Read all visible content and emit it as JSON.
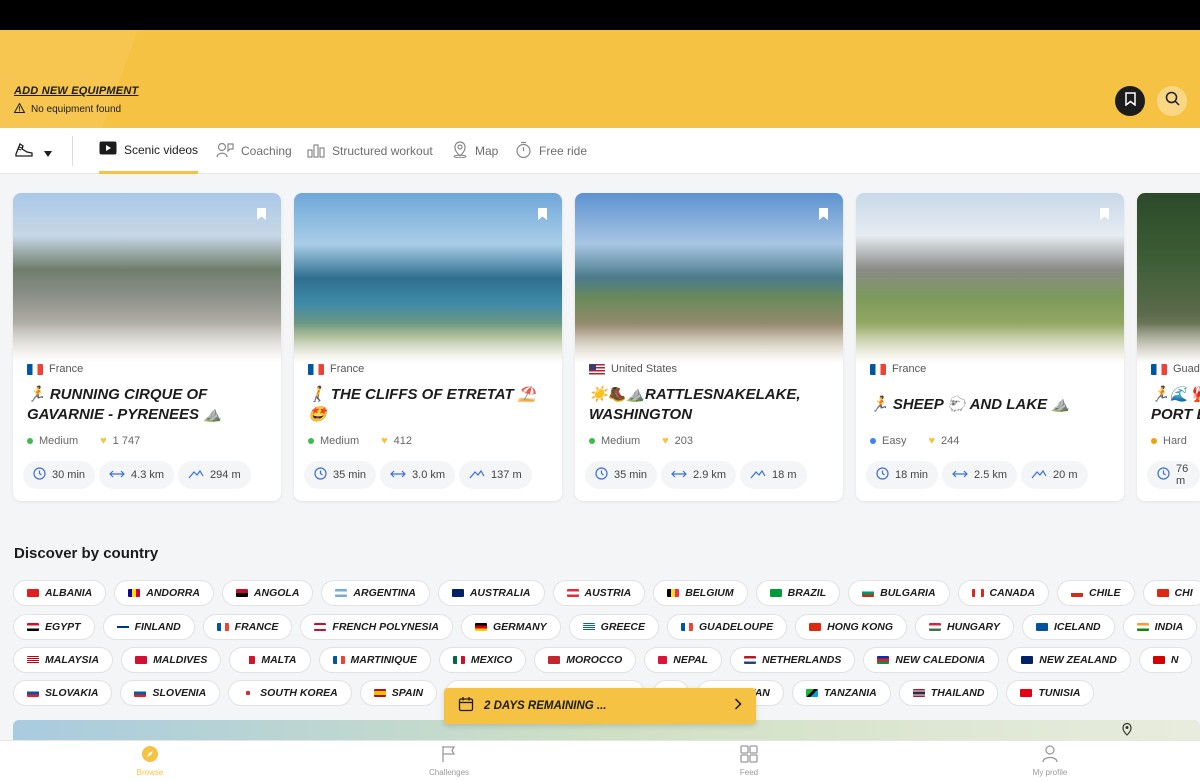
{
  "header": {
    "add_equipment": "ADD NEW EQUIPMENT",
    "no_equipment": "No equipment found"
  },
  "tabs": [
    {
      "label": "Scenic videos",
      "icon": "play-icon",
      "active": true
    },
    {
      "label": "Coaching",
      "icon": "coach-icon"
    },
    {
      "label": "Structured workout",
      "icon": "bar-chart-icon"
    },
    {
      "label": "Map",
      "icon": "map-pin-icon"
    },
    {
      "label": "Free ride",
      "icon": "stopwatch-icon"
    }
  ],
  "cards": [
    {
      "country": "France",
      "title": "🏃 RUNNING CIRQUE OF GAVARNIE - PYRENEES ⛰️",
      "level": "Medium",
      "level_color": "#3fb950",
      "likes": "1 747",
      "duration": "30 min",
      "distance": "4.3 km",
      "elevation": "294 m"
    },
    {
      "country": "France",
      "title": "🚶 THE CLIFFS OF ETRETAT ⛱️ 🤩",
      "level": "Medium",
      "level_color": "#3fb950",
      "likes": "412",
      "duration": "35 min",
      "distance": "3.0 km",
      "elevation": "137 m"
    },
    {
      "country": "United States",
      "title": "☀️🥾⛰️RATTLESNAKELAKE, WASHINGTON",
      "level": "Medium",
      "level_color": "#3fb950",
      "likes": "203",
      "duration": "35 min",
      "distance": "2.9 km",
      "elevation": "18 m"
    },
    {
      "country": "France",
      "title": "🏃 SHEEP 🐑 AND LAKE ⛰️",
      "level": "Easy",
      "level_color": "#3b82f6",
      "likes": "244",
      "duration": "18 min",
      "distance": "2.5 km",
      "elevation": "20 m"
    },
    {
      "country": "Guad",
      "title": "🏃🌊🦞 PORT L",
      "level": "Hard",
      "level_color": "#f59e0b",
      "likes": "",
      "duration": "76 m",
      "distance": "",
      "elevation": ""
    }
  ],
  "discover_title": "Discover by country",
  "countries": [
    [
      "ALBANIA",
      "ANDORRA",
      "ANGOLA",
      "ARGENTINA",
      "AUSTRALIA",
      "AUSTRIA",
      "BELGIUM",
      "BRAZIL",
      "BULGARIA",
      "CANADA",
      "CHILE",
      "CHI"
    ],
    [
      "EGYPT",
      "FINLAND",
      "FRANCE",
      "FRENCH POLYNESIA",
      "GERMANY",
      "GREECE",
      "GUADELOUPE",
      "HONG KONG",
      "HUNGARY",
      "ICELAND",
      "INDIA"
    ],
    [
      "MALAYSIA",
      "MALDIVES",
      "MALTA",
      "MARTINIQUE",
      "MEXICO",
      "MOROCCO",
      "NEPAL",
      "NETHERLANDS",
      "NEW CALEDONIA",
      "NEW ZEALAND",
      "N"
    ],
    [
      "SLOVAKIA",
      "SLOVENIA",
      "SOUTH KOREA",
      "SPAIN",
      "",
      "ND",
      "TAIWAN",
      "TANZANIA",
      "THAILAND",
      "TUNISIA"
    ]
  ],
  "banner": {
    "text": "2 DAYS REMAINING ..."
  },
  "bottom_nav": [
    {
      "label": "Browse",
      "icon": "compass-icon",
      "active": true
    },
    {
      "label": "Challenges",
      "icon": "flag-icon"
    },
    {
      "label": "Feed",
      "icon": "grid-icon"
    },
    {
      "label": "My profile",
      "icon": "user-icon"
    }
  ],
  "colors": {
    "accent": "#f6c243",
    "dark": "#1c1c1c"
  }
}
